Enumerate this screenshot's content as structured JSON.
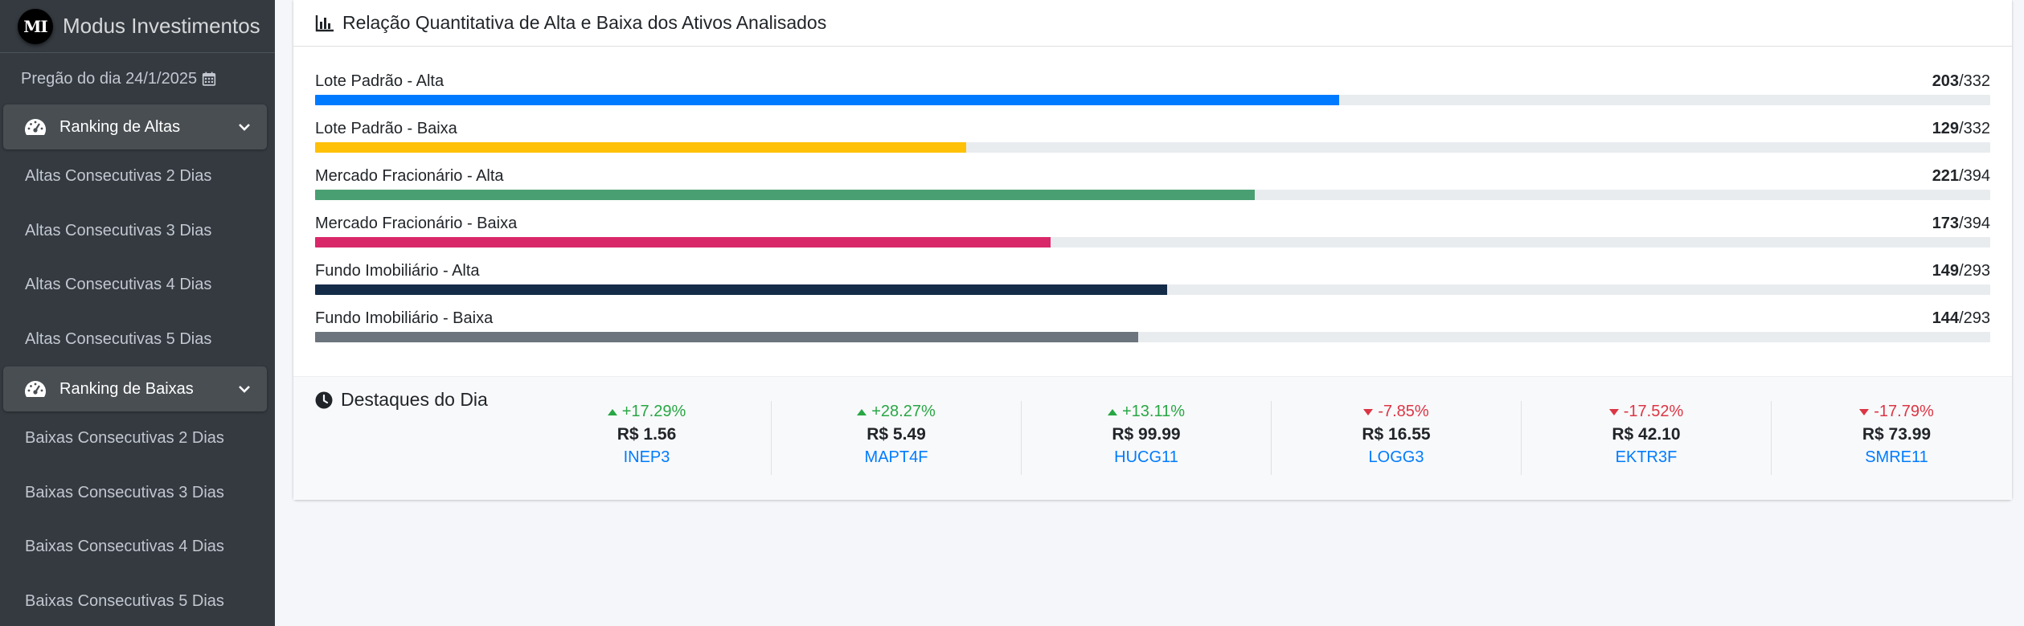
{
  "brand": {
    "logo_text": "MI",
    "name": "Modus Investimentos"
  },
  "session": {
    "label": "Pregão do dia 24/1/2025",
    "icon": "calendar-icon"
  },
  "sidebar": {
    "groups": [
      {
        "label": "Ranking de Altas",
        "icon": "gauge-icon",
        "items": [
          "Altas Consecutivas 2 Dias",
          "Altas Consecutivas 3 Dias",
          "Altas Consecutivas 4 Dias",
          "Altas Consecutivas 5 Dias"
        ]
      },
      {
        "label": "Ranking de Baixas",
        "icon": "gauge-icon",
        "items": [
          "Baixas Consecutivas 2 Dias",
          "Baixas Consecutivas 3 Dias",
          "Baixas Consecutivas 4 Dias",
          "Baixas Consecutivas 5 Dias"
        ]
      }
    ]
  },
  "card": {
    "title": "Relação Quantitativa de Alta e Baixa dos Ativos Analisados",
    "icon": "bar-chart-icon",
    "progress": [
      {
        "label": "Lote Padrão - Alta",
        "value": "203",
        "total": "/332",
        "fraction": 0.6114,
        "color": "#007bff"
      },
      {
        "label": "Lote Padrão - Baixa",
        "value": "129",
        "total": "/332",
        "fraction": 0.3886,
        "color": "#ffc107"
      },
      {
        "label": "Mercado Fracionário - Alta",
        "value": "221",
        "total": "/394",
        "fraction": 0.5609,
        "color": "#4a9f72"
      },
      {
        "label": "Mercado Fracionário - Baixa",
        "value": "173",
        "total": "/394",
        "fraction": 0.4391,
        "color": "#d9286a"
      },
      {
        "label": "Fundo Imobiliário - Alta",
        "value": "149",
        "total": "/293",
        "fraction": 0.5085,
        "color": "#152c48"
      },
      {
        "label": "Fundo Imobiliário - Baixa",
        "value": "144",
        "total": "/293",
        "fraction": 0.4915,
        "color": "#6c757d"
      }
    ]
  },
  "highlights": {
    "title": "Destaques do Dia",
    "icon": "clock-icon",
    "items": [
      {
        "change": "+17.29%",
        "direction": "up",
        "price": "R$ 1.56",
        "ticker": "INEP3"
      },
      {
        "change": "+28.27%",
        "direction": "up",
        "price": "R$ 5.49",
        "ticker": "MAPT4F"
      },
      {
        "change": "+13.11%",
        "direction": "up",
        "price": "R$ 99.99",
        "ticker": "HUCG11"
      },
      {
        "change": "-7.85%",
        "direction": "down",
        "price": "R$ 16.55",
        "ticker": "LOGG3"
      },
      {
        "change": "-17.52%",
        "direction": "down",
        "price": "R$ 42.10",
        "ticker": "EKTR3F"
      },
      {
        "change": "-17.79%",
        "direction": "down",
        "price": "R$ 73.99",
        "ticker": "SMRE11"
      }
    ]
  }
}
